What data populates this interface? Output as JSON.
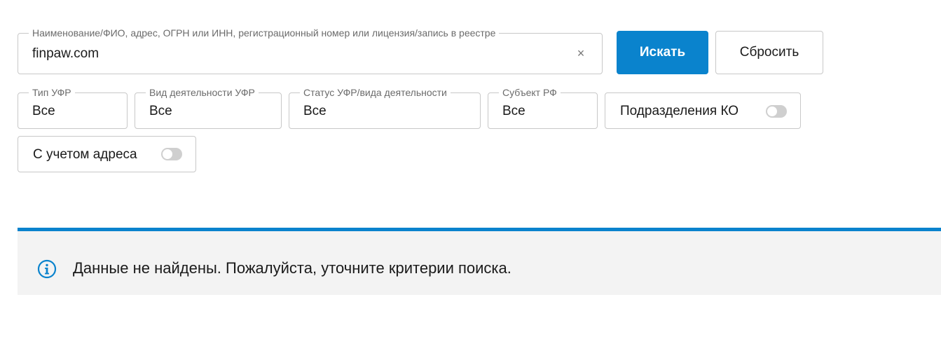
{
  "search": {
    "label": "Наименование/ФИО, адрес, ОГРН или ИНН, регистрационный номер или лицензия/запись в реестре",
    "value": "finpaw.com",
    "clear_glyph": "×"
  },
  "buttons": {
    "search_label": "Искать",
    "reset_label": "Сбросить"
  },
  "filters": {
    "type": {
      "label": "Тип УФР",
      "value": "Все"
    },
    "activity": {
      "label": "Вид деятельности УФР",
      "value": "Все"
    },
    "status": {
      "label": "Статус УФР/вида деятельности",
      "value": "Все"
    },
    "subject": {
      "label": "Субъект РФ",
      "value": "Все"
    }
  },
  "toggles": {
    "ko_divisions": {
      "label": "Подразделения КО",
      "on": false
    },
    "with_address": {
      "label": "С учетом адреса",
      "on": false
    }
  },
  "notice": {
    "icon": "info-icon",
    "message": "Данные не найдены. Пожалуйста, уточните критерии поиска."
  },
  "colors": {
    "accent": "#0a83cd",
    "notice_bg": "#f3f3f3",
    "border": "#c8c8c8",
    "toggle_off": "#cfcfcf"
  }
}
